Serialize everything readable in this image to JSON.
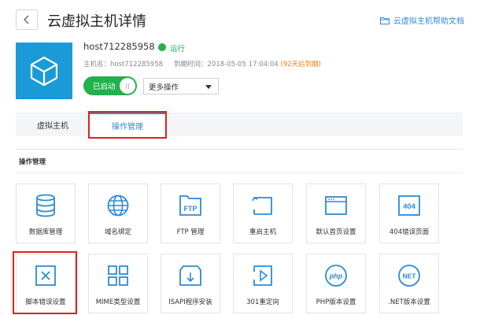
{
  "header": {
    "back_icon": "chevron-left-icon",
    "title": "云虚拟主机详情",
    "help_link": "云虚拟主机帮助文档",
    "help_icon": "folder-icon"
  },
  "host": {
    "logo_icon": "cube-icon",
    "name": "host712285958",
    "status": "运行",
    "status_color": "#21b34a",
    "hostname_label": "主机名：",
    "hostname": "host712285958",
    "expire_label": "到期时间：",
    "expire_time": "2018-05-05 17:04:04",
    "expire_note": "(92天后到期)",
    "started_label": "已启动",
    "more_actions": "更多操作"
  },
  "tabs": [
    {
      "label": "虚拟主机",
      "active": false
    },
    {
      "label": "操作管理",
      "active": true
    }
  ],
  "section": {
    "title": "操作管理"
  },
  "tiles": [
    {
      "label": "数据库管理",
      "icon": "database-icon"
    },
    {
      "label": "域名绑定",
      "icon": "globe-icon"
    },
    {
      "label": "FTP 管理",
      "icon": "ftp-folder-icon",
      "icon_text": "FTP"
    },
    {
      "label": "重启主机",
      "icon": "restart-icon"
    },
    {
      "label": "默认首页设置",
      "icon": "browser-window-icon"
    },
    {
      "label": "404错误页面",
      "icon": "404-page-icon",
      "icon_text": "404"
    },
    {
      "label": "脚本错误设置",
      "icon": "close-box-icon"
    },
    {
      "label": "MIME类型设置",
      "icon": "grid-icon"
    },
    {
      "label": "ISAPI程序安装",
      "icon": "download-box-icon"
    },
    {
      "label": "301重定向",
      "icon": "redirect-icon"
    },
    {
      "label": "PHP版本设置",
      "icon": "php-icon",
      "icon_text": "php"
    },
    {
      "label": ".NET版本设置",
      "icon": "net-icon",
      "icon_text": "NET"
    }
  ],
  "colors": {
    "accent": "#2c8bd8",
    "logo_bg": "#1a9ad7",
    "started_green": "#22b14c",
    "highlight_red": "#e02020",
    "expire_orange": "#ef7d1a"
  }
}
